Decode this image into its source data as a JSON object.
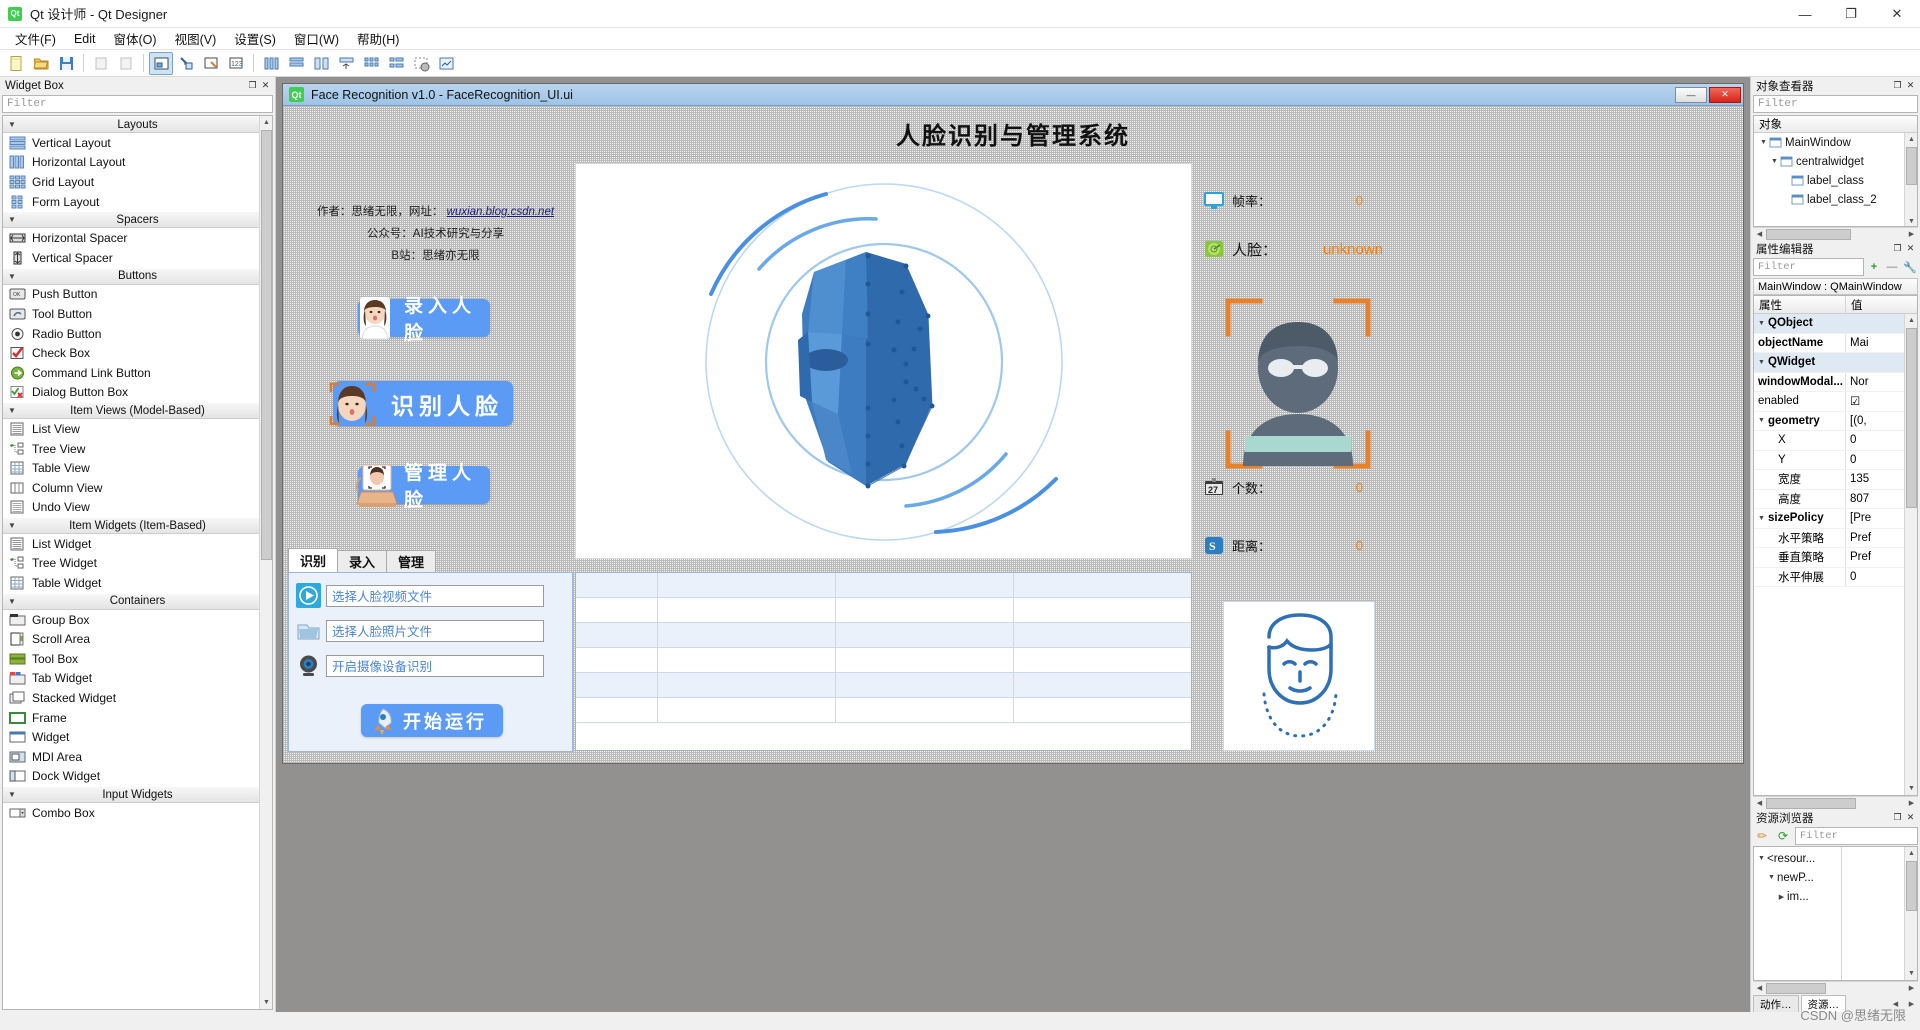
{
  "window": {
    "title": "Qt 设计师 - Qt Designer",
    "logo": "qt-logo",
    "minimize": "—",
    "maximize": "❐",
    "close": "✕"
  },
  "menubar": {
    "items": [
      {
        "label": "文件(F)"
      },
      {
        "label": "Edit"
      },
      {
        "label": "窗体(O)"
      },
      {
        "label": "视图(V)"
      },
      {
        "label": "设置(S)"
      },
      {
        "label": "窗口(W)"
      },
      {
        "label": "帮助(H)"
      }
    ]
  },
  "toolbar": {
    "groups": [
      {
        "buttons": [
          {
            "name": "new-form-icon",
            "glyph": "📄"
          },
          {
            "name": "open-form-icon",
            "glyph": "📂"
          },
          {
            "name": "save-form-icon",
            "glyph": "💾"
          }
        ]
      },
      {
        "buttons": [
          {
            "name": "undo-icon",
            "glyph": "▭"
          },
          {
            "name": "redo-icon",
            "glyph": "▭"
          }
        ]
      },
      {
        "buttons": [
          {
            "name": "edit-widgets-icon",
            "glyph": "▣",
            "active": true
          },
          {
            "name": "edit-signals-slots-icon",
            "glyph": "↘"
          },
          {
            "name": "edit-buddies-icon",
            "glyph": "◪"
          },
          {
            "name": "edit-tab-order-icon",
            "glyph": "123"
          }
        ]
      },
      {
        "buttons": [
          {
            "name": "layout-horizontally-icon",
            "glyph": "|||"
          },
          {
            "name": "layout-vertically-icon",
            "glyph": "≡"
          },
          {
            "name": "layout-splitter-horizontal-icon",
            "glyph": "⊨"
          },
          {
            "name": "layout-splitter-vertical-icon",
            "glyph": "⊼"
          },
          {
            "name": "layout-grid-icon",
            "glyph": "▦"
          },
          {
            "name": "layout-form-icon",
            "glyph": "▤"
          },
          {
            "name": "break-layout-icon",
            "glyph": "⬚"
          },
          {
            "name": "adjust-size-icon",
            "glyph": "⤢"
          }
        ]
      }
    ]
  },
  "widget_box": {
    "title": "Widget Box",
    "float_btn": "❐",
    "close_btn": "✕",
    "filter_placeholder": "Filter",
    "categories": [
      {
        "name": "Layouts",
        "items": [
          {
            "label": "Vertical Layout",
            "icon": "vertical-layout-icon"
          },
          {
            "label": "Horizontal Layout",
            "icon": "horizontal-layout-icon"
          },
          {
            "label": "Grid Layout",
            "icon": "grid-layout-icon"
          },
          {
            "label": "Form Layout",
            "icon": "form-layout-icon"
          }
        ]
      },
      {
        "name": "Spacers",
        "items": [
          {
            "label": "Horizontal Spacer",
            "icon": "horizontal-spacer-icon"
          },
          {
            "label": "Vertical Spacer",
            "icon": "vertical-spacer-icon"
          }
        ]
      },
      {
        "name": "Buttons",
        "items": [
          {
            "label": "Push Button",
            "icon": "push-button-icon"
          },
          {
            "label": "Tool Button",
            "icon": "tool-button-icon"
          },
          {
            "label": "Radio Button",
            "icon": "radio-button-icon"
          },
          {
            "label": "Check Box",
            "icon": "check-box-icon"
          },
          {
            "label": "Command Link Button",
            "icon": "command-link-button-icon"
          },
          {
            "label": "Dialog Button Box",
            "icon": "dialog-button-box-icon"
          }
        ]
      },
      {
        "name": "Item Views (Model-Based)",
        "items": [
          {
            "label": "List View",
            "icon": "list-view-icon"
          },
          {
            "label": "Tree View",
            "icon": "tree-view-icon"
          },
          {
            "label": "Table View",
            "icon": "table-view-icon"
          },
          {
            "label": "Column View",
            "icon": "column-view-icon"
          },
          {
            "label": "Undo View",
            "icon": "undo-view-icon"
          }
        ]
      },
      {
        "name": "Item Widgets (Item-Based)",
        "items": [
          {
            "label": "List Widget",
            "icon": "list-widget-icon"
          },
          {
            "label": "Tree Widget",
            "icon": "tree-widget-icon"
          },
          {
            "label": "Table Widget",
            "icon": "table-widget-icon"
          }
        ]
      },
      {
        "name": "Containers",
        "items": [
          {
            "label": "Group Box",
            "icon": "group-box-icon"
          },
          {
            "label": "Scroll Area",
            "icon": "scroll-area-icon"
          },
          {
            "label": "Tool Box",
            "icon": "tool-box-icon"
          },
          {
            "label": "Tab Widget",
            "icon": "tab-widget-icon"
          },
          {
            "label": "Stacked Widget",
            "icon": "stacked-widget-icon"
          },
          {
            "label": "Frame",
            "icon": "frame-icon"
          },
          {
            "label": "Widget",
            "icon": "widget-icon"
          },
          {
            "label": "MDI Area",
            "icon": "mdi-area-icon"
          },
          {
            "label": "Dock Widget",
            "icon": "dock-widget-icon"
          }
        ]
      },
      {
        "name": "Input Widgets",
        "items": [
          {
            "label": "Combo Box",
            "icon": "combo-box-icon"
          }
        ]
      }
    ]
  },
  "form": {
    "titlebar": {
      "logo": "Qt",
      "title": "Face Recognition v1.0 - FaceRecognition_UI.ui",
      "minimize": "—",
      "close": "✕"
    },
    "heading": "人脸识别与管理系统",
    "author_lines": [
      {
        "prefix": "作者：思绪无限，网址：",
        "link": "wuxian.blog.csdn.net"
      },
      {
        "prefix": "公众号：AI技术研究与分享",
        "link": ""
      },
      {
        "prefix": "B站：思绪亦无限",
        "link": ""
      }
    ],
    "action_buttons": [
      {
        "label": "录入人脸",
        "icon": "enroll-face-icon"
      },
      {
        "label": "识别人脸",
        "icon": "recognize-face-icon"
      },
      {
        "label": "管理人脸",
        "icon": "manage-face-icon"
      }
    ],
    "stats": [
      {
        "label": "帧率：",
        "value": "0",
        "icon": "monitor-icon"
      },
      {
        "label": "人脸：",
        "value": "unknown",
        "icon": "radar-icon"
      },
      {
        "label": "个数：",
        "value": "0",
        "icon": "calendar-icon"
      },
      {
        "label": "距离：",
        "value": "0",
        "icon": "distance-icon"
      }
    ],
    "tabs": [
      {
        "label": "识别",
        "active": true
      },
      {
        "label": "录入",
        "active": false
      },
      {
        "label": "管理",
        "active": false
      }
    ],
    "file_rows": [
      {
        "value": "选择人脸视频文件",
        "icon": "video-file-icon"
      },
      {
        "value": "选择人脸照片文件",
        "icon": "photo-file-icon"
      },
      {
        "value": "开启摄像设备识别",
        "icon": "camera-icon"
      }
    ],
    "run_button": {
      "label": "开始运行",
      "icon": "rocket-icon"
    },
    "table": {
      "rows": 6,
      "cols": 4
    },
    "preview_image": "face-3d-scan-image",
    "person_image": "person-avatar-image",
    "face_card_image": "face-outline-image"
  },
  "object_inspector": {
    "title": "对象查看器",
    "float_btn": "❐",
    "close_btn": "✕",
    "filter_placeholder": "Filter",
    "header": "对象",
    "nodes": [
      {
        "label": "MainWindow",
        "depth": 0,
        "expanded": true,
        "icon": "mainwindow-icon"
      },
      {
        "label": "centralwidget",
        "depth": 1,
        "expanded": true,
        "icon": "widget-icon"
      },
      {
        "label": "label_class",
        "depth": 2,
        "expanded": false,
        "icon": "label-icon"
      },
      {
        "label": "label_class_2",
        "depth": 2,
        "expanded": false,
        "icon": "label-icon"
      }
    ]
  },
  "property_editor": {
    "title": "属性编辑器",
    "float_btn": "❐",
    "close_btn": "✕",
    "filter_placeholder": "Filter",
    "add_btn": "+",
    "remove_btn": "—",
    "config_btn": "🔧",
    "object_line": "MainWindow : QMainWindow",
    "col_headers": [
      "属性",
      "值"
    ],
    "rows": [
      {
        "name": "QObject",
        "value": "",
        "type": "group",
        "depth": 0
      },
      {
        "name": "objectName",
        "value": "Mai",
        "type": "bold",
        "depth": 1
      },
      {
        "name": "QWidget",
        "value": "",
        "type": "group",
        "depth": 0
      },
      {
        "name": "windowModal...",
        "value": "Nor",
        "type": "bold",
        "depth": 1
      },
      {
        "name": "enabled",
        "value": "☑",
        "type": "normal",
        "depth": 1
      },
      {
        "name": "geometry",
        "value": "[(0,",
        "type": "bold-expand",
        "depth": 0
      },
      {
        "name": "X",
        "value": "0",
        "type": "sub",
        "depth": 2
      },
      {
        "name": "Y",
        "value": "0",
        "type": "sub",
        "depth": 2
      },
      {
        "name": "宽度",
        "value": "135",
        "type": "sub",
        "depth": 2
      },
      {
        "name": "高度",
        "value": "807",
        "type": "sub",
        "depth": 2
      },
      {
        "name": "sizePolicy",
        "value": "[Pre",
        "type": "bold-expand",
        "depth": 0
      },
      {
        "name": "水平策略",
        "value": "Pref",
        "type": "sub",
        "depth": 2
      },
      {
        "name": "垂直策略",
        "value": "Pref",
        "type": "sub",
        "depth": 2
      },
      {
        "name": "水平伸展",
        "value": "0",
        "type": "sub",
        "depth": 2
      }
    ]
  },
  "resource_browser": {
    "title": "资源浏览器",
    "float_btn": "❐",
    "close_btn": "✕",
    "edit_btn": "✏",
    "reload_btn": "⟳",
    "filter_placeholder": "Filter",
    "tree": [
      {
        "label": "<resour...",
        "depth": 0,
        "expanded": true
      },
      {
        "label": "newP...",
        "depth": 1,
        "expanded": true
      },
      {
        "label": "im...",
        "depth": 2,
        "expanded": false
      }
    ],
    "bottom_tabs": [
      {
        "label": "动作…",
        "active": false
      },
      {
        "label": "资源…",
        "active": true
      }
    ]
  },
  "watermark": "CSDN @思绪无限",
  "colors": {
    "accent_blue": "#5b9bf5",
    "orange_value": "#ff7b00",
    "qt_green": "#41cd52",
    "close_red": "#d9221a"
  }
}
